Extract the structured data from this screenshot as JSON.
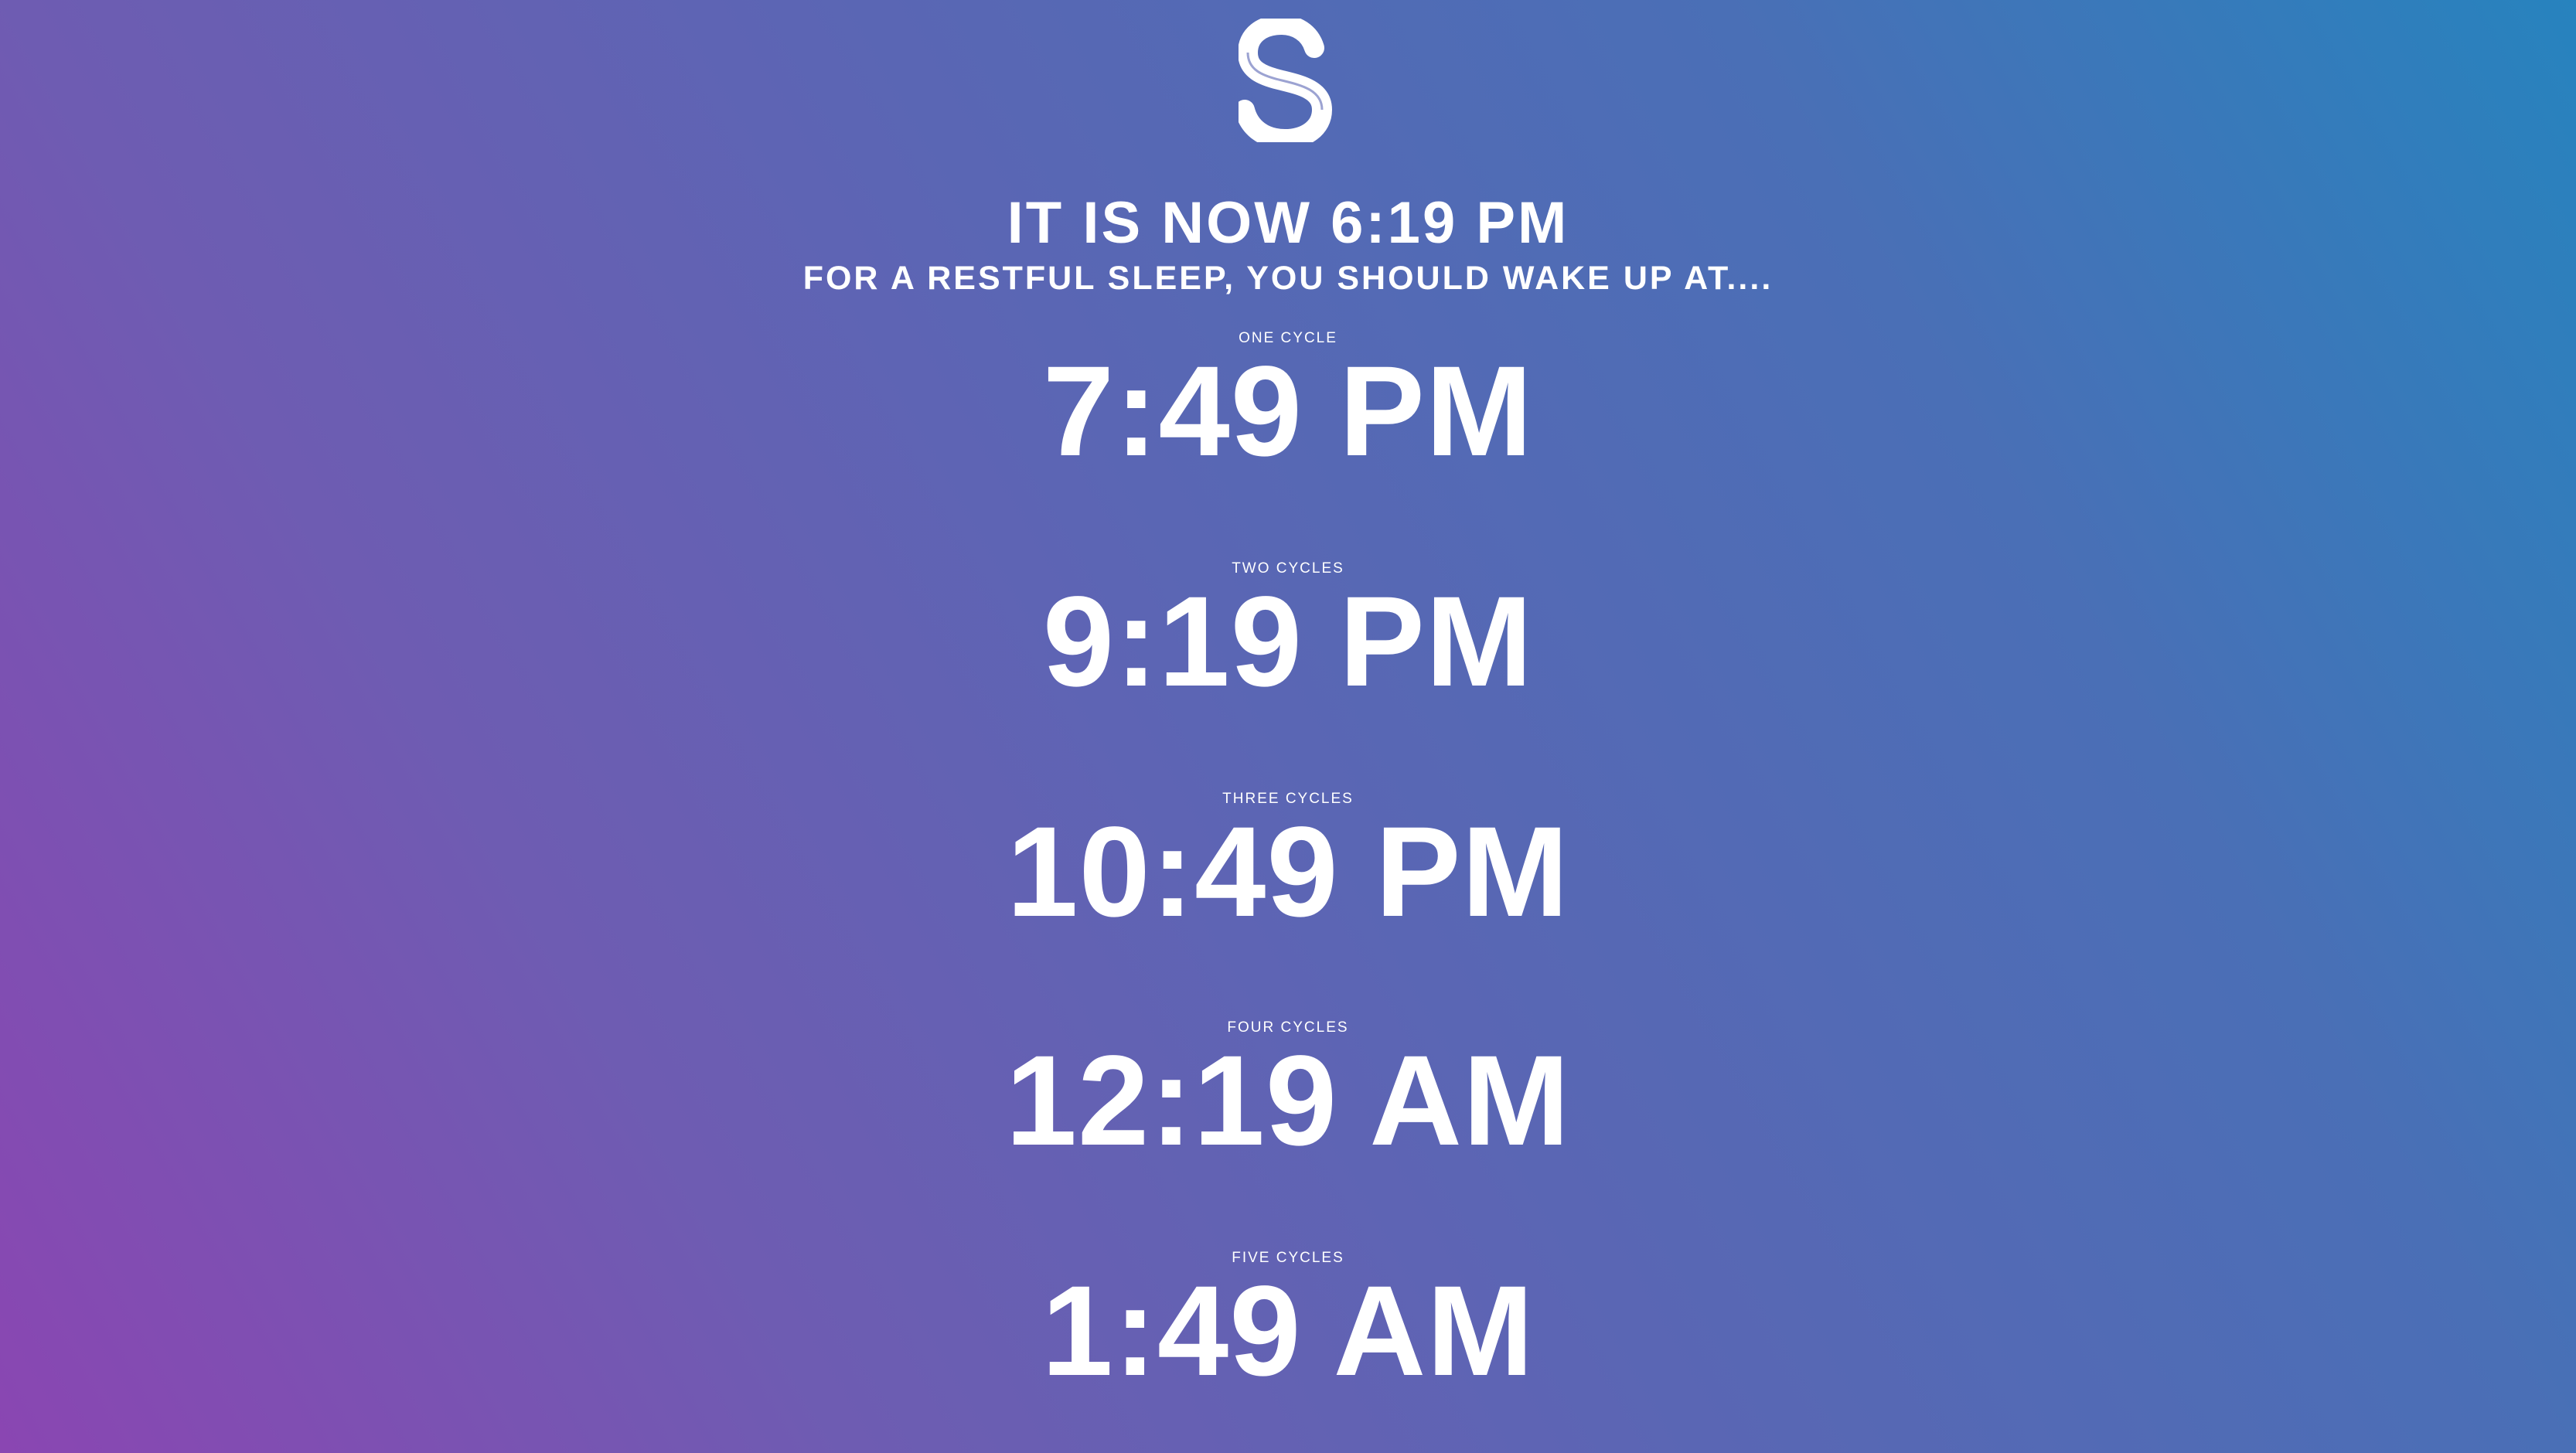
{
  "logo": {
    "icon": "s-logo-icon"
  },
  "header": {
    "now_text": "IT IS NOW 6:19 PM",
    "subtitle": "FOR A RESTFUL SLEEP, YOU SHOULD WAKE UP AT...."
  },
  "cycles": [
    {
      "label": "ONE CYCLE",
      "time": "7:49 PM"
    },
    {
      "label": "TWO CYCLES",
      "time": "9:19 PM"
    },
    {
      "label": "THREE CYCLES",
      "time": "10:49 PM"
    },
    {
      "label": "FOUR CYCLES",
      "time": "12:19 AM"
    },
    {
      "label": "FIVE CYCLES",
      "time": "1:49 AM"
    }
  ],
  "colors": {
    "gradient_start": "#8a46b2",
    "gradient_end": "#2783be",
    "text": "#ffffff"
  }
}
